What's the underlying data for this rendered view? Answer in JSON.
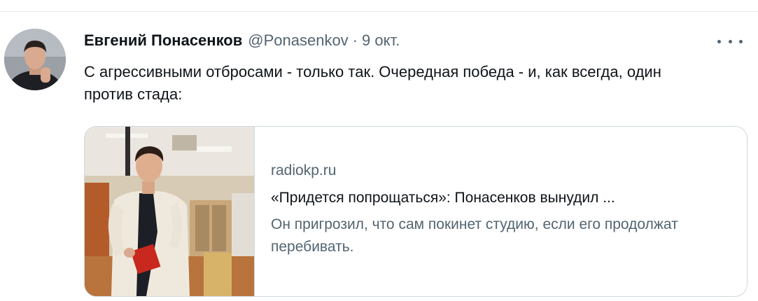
{
  "tweet": {
    "display_name": "Евгений Понасенков",
    "handle": "@Ponasenkov",
    "separator": "·",
    "time": "9 окт.",
    "text": "С агрессивными отбросами - только так. Очередная победа - и, как всегда, один против стада:"
  },
  "card": {
    "domain": "radiokp.ru",
    "title": "«Придется попрощаться»: Понасенков вынудил ...",
    "description": "Он пригрозил, что сам покинет студию, если его продолжат перебивать."
  },
  "icons": {
    "more": "more-horizontal-icon"
  },
  "colors": {
    "border": "#cfd9de",
    "secondary_text": "#536471",
    "primary_text": "#0f1419"
  }
}
